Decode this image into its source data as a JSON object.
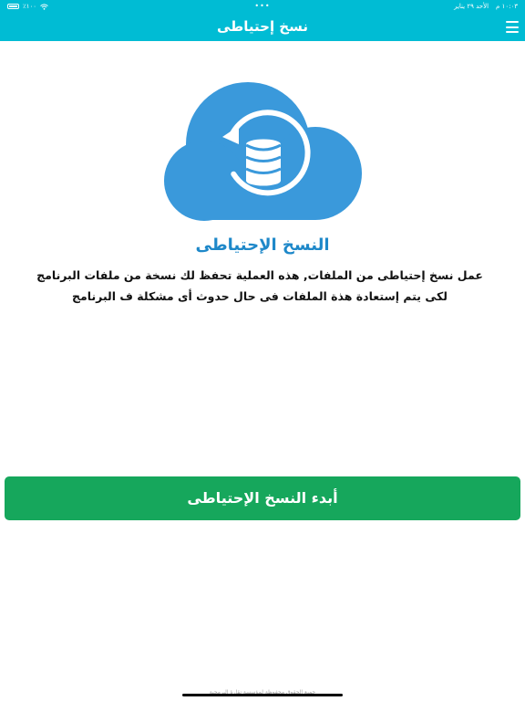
{
  "status_bar": {
    "battery_text": "٪١٠٠",
    "battery_level": 1.0,
    "center_dots": "•••",
    "time": "١٠:٠٣ م",
    "date": "الأحد ٢٩ يناير"
  },
  "app_bar": {
    "title": "نسخ إحتياطى",
    "menu_icon": "hamburger-menu-icon"
  },
  "hero": {
    "icon": "cloud-backup-database-icon",
    "color": "#3a99db"
  },
  "content": {
    "title": "النسخ الإحتياطى",
    "description": "عمل نسخ إحتياطى من الملفات, هذه العملية تحفظ لك نسخة من ملفات البرنامج لكى يتم إستعادة هذة الملفات فى حال حدوث أى مشكلة ف البرنامج"
  },
  "actions": {
    "start_backup_label": "أبدء النسخ الإحتياطى"
  },
  "footer": {
    "text": "جميع الحقوق محفوظة لمؤسسة نقارة البرمجية"
  },
  "colors": {
    "primary": "#00bcd4",
    "accent_text": "#1e88c9",
    "button": "#16a75c"
  }
}
